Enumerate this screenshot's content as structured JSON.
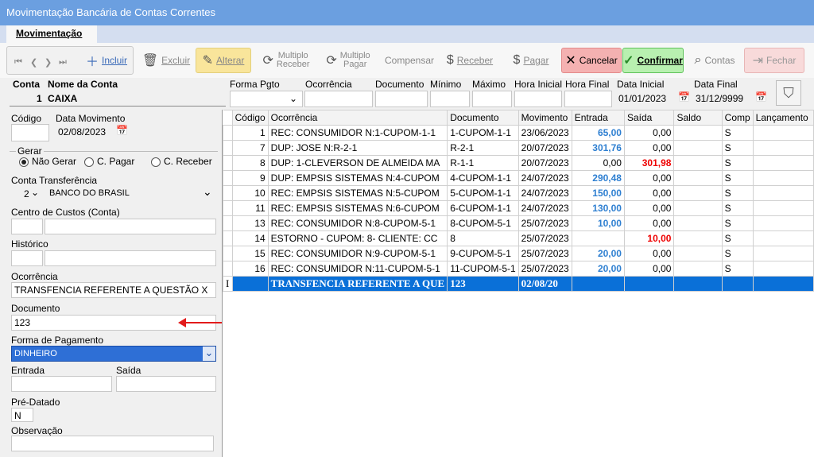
{
  "window": {
    "title": "Movimentação Bancária de Contas Correntes"
  },
  "tabs": [
    {
      "label": "Movimentação"
    }
  ],
  "toolbar": {
    "incluir": "Incluir",
    "excluir": "Excluir",
    "alterar": "Alterar",
    "multiplo_receber_1": "Multiplo",
    "multiplo_receber_2": "Receber",
    "multiplo_pagar_1": "Multiplo",
    "multiplo_pagar_2": "Pagar",
    "compensar": "Compensar",
    "receber": "Receber",
    "pagar": "Pagar",
    "cancelar": "Cancelar",
    "confirmar": "Confirmar",
    "contas": "Contas",
    "fechar": "Fechar"
  },
  "header": {
    "conta_label": "Conta",
    "conta_value": "1",
    "nome_conta_label": "Nome da Conta",
    "nome_conta_value": "CAIXA",
    "forma_pgto_label": "Forma Pgto",
    "ocorrencia_label": "Ocorrência",
    "documento_label": "Documento",
    "minimo_label": "Mínimo",
    "maximo_label": "Máximo",
    "hora_inicial_label": "Hora Inicial",
    "hora_final_label": "Hora Final",
    "data_inicial_label": "Data Inicial",
    "data_inicial_value": "01/01/2023",
    "data_final_label": "Data Final",
    "data_final_value": "31/12/9999"
  },
  "form": {
    "codigo_label": "Código",
    "data_mov_label": "Data Movimento",
    "data_mov_value": "02/08/2023",
    "gerar_label": "Gerar",
    "gerar_opts": [
      "Não Gerar",
      "C. Pagar",
      "C. Receber"
    ],
    "conta_transf_label": "Conta Transferência",
    "conta_transf_num": "2",
    "conta_transf_name": "BANCO DO BRASIL",
    "centro_custos_label": "Centro de Custos (Conta)",
    "historico_label": "Histórico",
    "ocorrencia_label": "Ocorrência",
    "ocorrencia_value": "TRANSFENCIA REFERENTE A QUESTÃO X",
    "documento_label": "Documento",
    "documento_value": "123",
    "forma_pag_label": "Forma de Pagamento",
    "forma_pag_value": "DINHEIRO",
    "entrada_label": "Entrada",
    "saida_label": "Saída",
    "pre_datado_label": "Pré-Datado",
    "pre_datado_value": "N",
    "observacao_label": "Observação"
  },
  "grid": {
    "columns": [
      "Código",
      "Ocorrência",
      "Documento",
      "Movimento",
      "Entrada",
      "Saída",
      "Saldo",
      "Comp",
      "Lançamento"
    ],
    "rows": [
      {
        "codigo": "1",
        "ocorrencia": "REC: CONSUMIDOR N:1-CUPOM-1-1",
        "documento": "1-CUPOM-1-1",
        "movimento": "23/06/2023",
        "entrada": "65,00",
        "saida": "0,00",
        "comp": "S"
      },
      {
        "codigo": "7",
        "ocorrencia": "DUP: JOSE N:R-2-1",
        "documento": "R-2-1",
        "movimento": "20/07/2023",
        "entrada": "301,76",
        "saida": "0,00",
        "comp": "S"
      },
      {
        "codigo": "8",
        "ocorrencia": "DUP: 1-CLEVERSON DE ALMEIDA MA",
        "documento": "R-1-1",
        "movimento": "20/07/2023",
        "entrada": "0,00",
        "saida": "301,98",
        "comp": "S"
      },
      {
        "codigo": "9",
        "ocorrencia": "DUP: EMPSIS SISTEMAS N:4-CUPOM",
        "documento": "4-CUPOM-1-1",
        "movimento": "24/07/2023",
        "entrada": "290,48",
        "saida": "0,00",
        "comp": "S"
      },
      {
        "codigo": "10",
        "ocorrencia": "REC: EMPSIS SISTEMAS N:5-CUPOM",
        "documento": "5-CUPOM-1-1",
        "movimento": "24/07/2023",
        "entrada": "150,00",
        "saida": "0,00",
        "comp": "S"
      },
      {
        "codigo": "11",
        "ocorrencia": "REC: EMPSIS SISTEMAS N:6-CUPOM",
        "documento": "6-CUPOM-1-1",
        "movimento": "24/07/2023",
        "entrada": "130,00",
        "saida": "0,00",
        "comp": "S"
      },
      {
        "codigo": "13",
        "ocorrencia": "REC: CONSUMIDOR N:8-CUPOM-5-1",
        "documento": "8-CUPOM-5-1",
        "movimento": "25/07/2023",
        "entrada": "10,00",
        "saida": "0,00",
        "comp": "S"
      },
      {
        "codigo": "14",
        "ocorrencia": "ESTORNO - CUPOM: 8- CLIENTE: CC",
        "documento": "8",
        "movimento": "25/07/2023",
        "entrada": "",
        "saida": "10,00",
        "comp": "S"
      },
      {
        "codigo": "15",
        "ocorrencia": "REC: CONSUMIDOR N:9-CUPOM-5-1",
        "documento": "9-CUPOM-5-1",
        "movimento": "25/07/2023",
        "entrada": "20,00",
        "saida": "0,00",
        "comp": "S"
      },
      {
        "codigo": "16",
        "ocorrencia": "REC: CONSUMIDOR N:11-CUPOM-5-1",
        "documento": "11-CUPOM-5-1",
        "movimento": "25/07/2023",
        "entrada": "20,00",
        "saida": "0,00",
        "comp": "S"
      }
    ],
    "editing_row": {
      "marker": "I",
      "ocorrencia": "TRANSFENCIA REFERENTE A QUE",
      "documento": "123",
      "movimento": "02/08/20"
    }
  },
  "colors": {
    "title_bar": "#6b9fe0",
    "selection": "#0a70d8",
    "positive": "#2e7fd1",
    "negative": "#e00000",
    "annotation_arrow": "#e21b1b"
  }
}
